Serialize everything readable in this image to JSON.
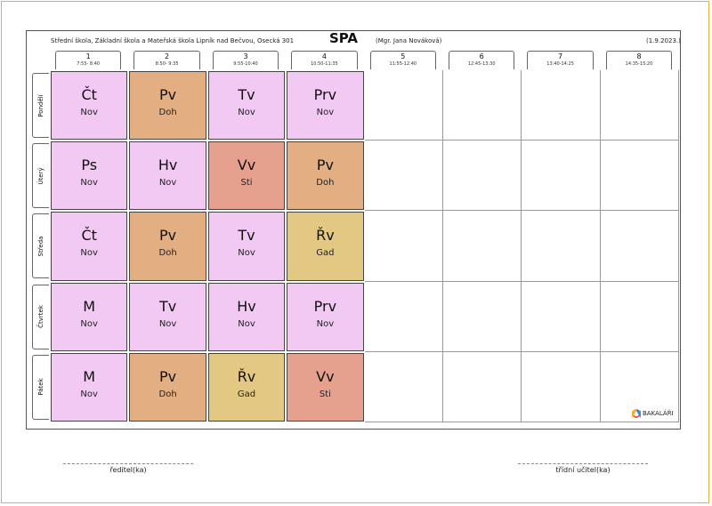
{
  "header": {
    "school": "Střední škola, Základní škola a Mateřská škola Lipník nad Bečvou, Osecká 301",
    "title": "SPA",
    "teacher": "(Mgr. Jana Nováková)",
    "date": "(1.9.2023.)"
  },
  "periods": [
    {
      "num": "1",
      "time": "7:55- 8:40"
    },
    {
      "num": "2",
      "time": "8:50- 9:35"
    },
    {
      "num": "3",
      "time": "9:55-10:40"
    },
    {
      "num": "4",
      "time": "10:50-11:35"
    },
    {
      "num": "5",
      "time": "11:55-12:40"
    },
    {
      "num": "6",
      "time": "12:45-13:30"
    },
    {
      "num": "7",
      "time": "13:40-14:25"
    },
    {
      "num": "8",
      "time": "14:35-15:20"
    }
  ],
  "days": [
    "Pondělí",
    "Úterý",
    "Středa",
    "Čtvrtek",
    "Pátek"
  ],
  "schedule": [
    [
      {
        "s": "Čt",
        "t": "Nov",
        "c": "#f1c9f3"
      },
      {
        "s": "Pv",
        "t": "Doh",
        "c": "#e2ae82"
      },
      {
        "s": "Tv",
        "t": "Nov",
        "c": "#f1c9f3"
      },
      {
        "s": "Prv",
        "t": "Nov",
        "c": "#f1c9f3"
      }
    ],
    [
      {
        "s": "Ps",
        "t": "Nov",
        "c": "#f1c9f3"
      },
      {
        "s": "Hv",
        "t": "Nov",
        "c": "#f1c9f3"
      },
      {
        "s": "Vv",
        "t": "Sti",
        "c": "#e5a18e"
      },
      {
        "s": "Pv",
        "t": "Doh",
        "c": "#e2ae82"
      }
    ],
    [
      {
        "s": "Čt",
        "t": "Nov",
        "c": "#f1c9f3"
      },
      {
        "s": "Pv",
        "t": "Doh",
        "c": "#e2ae82"
      },
      {
        "s": "Tv",
        "t": "Nov",
        "c": "#f1c9f3"
      },
      {
        "s": "Řv",
        "t": "Gad",
        "c": "#e3c883"
      }
    ],
    [
      {
        "s": "M",
        "t": "Nov",
        "c": "#f1c9f3"
      },
      {
        "s": "Tv",
        "t": "Nov",
        "c": "#f1c9f3"
      },
      {
        "s": "Hv",
        "t": "Nov",
        "c": "#f1c9f3"
      },
      {
        "s": "Prv",
        "t": "Nov",
        "c": "#f1c9f3"
      }
    ],
    [
      {
        "s": "M",
        "t": "Nov",
        "c": "#f1c9f3"
      },
      {
        "s": "Pv",
        "t": "Doh",
        "c": "#e2ae82"
      },
      {
        "s": "Řv",
        "t": "Gad",
        "c": "#e3c883"
      },
      {
        "s": "Vv",
        "t": "Sti",
        "c": "#e5a18e"
      }
    ]
  ],
  "logo": {
    "text": "BAKALÁŘI",
    "icon": "hexagon-logo-icon"
  },
  "signatures": {
    "left": "ředitel(ka)",
    "right": "třídní učitel(ka)"
  }
}
